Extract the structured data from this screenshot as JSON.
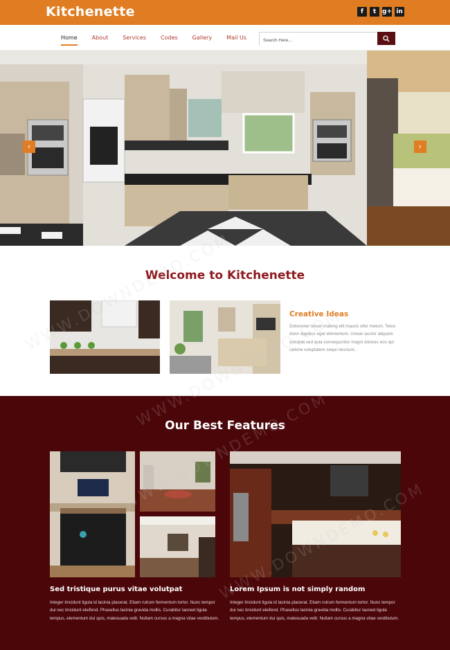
{
  "brand": {
    "name": "Kitchenette",
    "accent": "#e07d22",
    "dark": "#4b060a",
    "title_red": "#8e1a1e"
  },
  "social": [
    {
      "icon": "facebook-icon",
      "glyph": "f"
    },
    {
      "icon": "twitter-icon",
      "glyph": "t"
    },
    {
      "icon": "google-plus-icon",
      "glyph": "g+"
    },
    {
      "icon": "linkedin-icon",
      "glyph": "in"
    }
  ],
  "nav": {
    "items": [
      "Home",
      "About",
      "Services",
      "Codes",
      "Gallery",
      "Mail Us"
    ],
    "active": "Home"
  },
  "search": {
    "placeholder": "Search Here..."
  },
  "welcome": {
    "title": "Welcome to Kitchenette",
    "subtitle": "Creative Ideas",
    "text": "Doloremer tetuer maleng elit mauris sifer metum. Tetus dolor dapibus eget elementum. Unean auctor aliquam volutpat.sed quia consequuntur magni dolores eos qui ratione voluptatem sequi nesciunt.."
  },
  "features": {
    "title": "Our Best Features",
    "items": [
      {
        "heading": "Sed tristique purus vitae volutpat",
        "text": "Integer tincidunt ligula id lacinia placerat. Etiam rutrum fermentum tortor. Nunc tempor dui nec tincidunt eleifend. Phasellus lacinia gravida mollis. Curabitur laoreet ligula tempus, elementum dui quis, malesuada velit. Nullam cursus a magna vitae vestibulum."
      },
      {
        "heading": "Lorem Ipsum is not simply random",
        "text": "Integer tincidunt ligula id lacinia placerat. Etiam rutrum fermentum tortor. Nunc tempor dui nec tincidunt eleifend. Phasellus lacinia gravida mollis. Curabitur laoreet ligula tempus, elementum dui quis, malesuada velit. Nullam cursus a magna vitae vestibulum."
      }
    ]
  },
  "watermark": "WWW.DOWNDEMO.COM"
}
